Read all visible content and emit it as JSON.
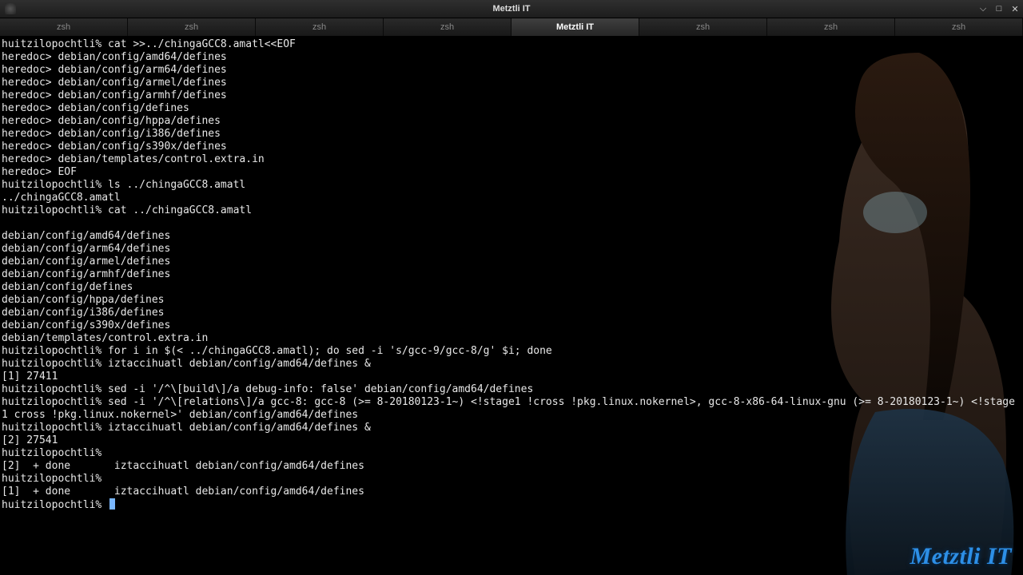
{
  "window": {
    "title": "Metztli IT",
    "buttons": {
      "min": "⌵",
      "max": "□",
      "close": "✕"
    }
  },
  "tabs": [
    {
      "label": "zsh",
      "active": false
    },
    {
      "label": "zsh",
      "active": false
    },
    {
      "label": "zsh",
      "active": false
    },
    {
      "label": "zsh",
      "active": false
    },
    {
      "label": "Metztli IT",
      "active": true
    },
    {
      "label": "zsh",
      "active": false
    },
    {
      "label": "zsh",
      "active": false
    },
    {
      "label": "zsh",
      "active": false
    }
  ],
  "watermark": "Metztli IT",
  "terminal_lines": [
    "huitzilopochtli% cat >>../chingaGCC8.amatl<<EOF",
    "heredoc> debian/config/amd64/defines",
    "heredoc> debian/config/arm64/defines",
    "heredoc> debian/config/armel/defines",
    "heredoc> debian/config/armhf/defines",
    "heredoc> debian/config/defines",
    "heredoc> debian/config/hppa/defines",
    "heredoc> debian/config/i386/defines",
    "heredoc> debian/config/s390x/defines",
    "heredoc> debian/templates/control.extra.in",
    "heredoc> EOF",
    "huitzilopochtli% ls ../chingaGCC8.amatl",
    "../chingaGCC8.amatl",
    "huitzilopochtli% cat ../chingaGCC8.amatl",
    "",
    "debian/config/amd64/defines",
    "debian/config/arm64/defines",
    "debian/config/armel/defines",
    "debian/config/armhf/defines",
    "debian/config/defines",
    "debian/config/hppa/defines",
    "debian/config/i386/defines",
    "debian/config/s390x/defines",
    "debian/templates/control.extra.in",
    "huitzilopochtli% for i in $(< ../chingaGCC8.amatl); do sed -i 's/gcc-9/gcc-8/g' $i; done",
    "huitzilopochtli% iztaccihuatl debian/config/amd64/defines &",
    "[1] 27411",
    "huitzilopochtli% sed -i '/^\\[build\\]/a debug-info: false' debian/config/amd64/defines",
    "huitzilopochtli% sed -i '/^\\[relations\\]/a gcc-8: gcc-8 (>= 8-20180123-1~) <!stage1 !cross !pkg.linux.nokernel>, gcc-8-x86-64-linux-gnu (>= 8-20180123-1~) <!stage1 cross !pkg.linux.nokernel>' debian/config/amd64/defines",
    "huitzilopochtli% iztaccihuatl debian/config/amd64/defines &",
    "[2] 27541",
    "huitzilopochtli%",
    "[2]  + done       iztaccihuatl debian/config/amd64/defines",
    "huitzilopochtli%",
    "[1]  + done       iztaccihuatl debian/config/amd64/defines",
    "huitzilopochtli% "
  ]
}
